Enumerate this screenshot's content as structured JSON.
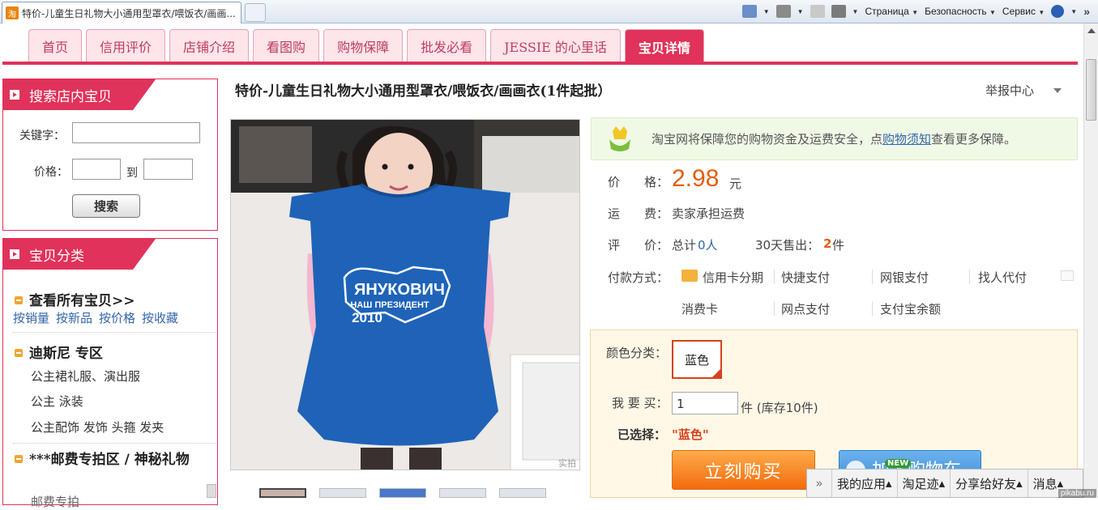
{
  "browser": {
    "tab_title": "特价-儿童生日礼物大小通用型罩衣/喂饭衣/画画...",
    "favicon": "淘",
    "menus": [
      "Страница",
      "Безопасность",
      "Сервис"
    ]
  },
  "nav": {
    "tabs": [
      "首页",
      "信用评价",
      "店铺介绍",
      "看图购",
      "购物保障",
      "批发必看",
      "JESSIE 的心里话",
      "宝贝详情"
    ]
  },
  "search": {
    "heading": "搜索店内宝贝",
    "keyword_label": "关键字：",
    "price_label": "价格：",
    "to_label": "到",
    "button": "搜索"
  },
  "categories": {
    "heading": "宝贝分类",
    "all_items": "查看所有宝贝>>",
    "sorts": [
      "按销量",
      "按新品",
      "按价格",
      "按收藏"
    ],
    "disney": "迪斯尼 专区",
    "disney_items": [
      "公主裙礼服、演出服",
      "公主 泳装",
      "公主配饰 发饰 头箍 发夹"
    ],
    "postage": "***邮费专拍区 / 神秘礼物",
    "postage_sub": "邮费专拍"
  },
  "product": {
    "title": "特价-儿童生日礼物大小通用型罩衣/喂饭衣/画画衣(1件起批）",
    "report": "举报中心",
    "apron_line1": "ЯНУКОВИЧ",
    "apron_line2": "НАШ ПРЕЗИДЕНТ",
    "apron_year": "2010",
    "photo_watermark": "实拍"
  },
  "guarantee": {
    "text_before": "淘宝网将保障您的购物资金及运费安全，点",
    "link": "购物须知",
    "text_after": "查看更多保障。"
  },
  "info": {
    "price_label": "价　　格：",
    "price": "2.98",
    "currency": "元",
    "shipping_label": "运　　费：",
    "shipping": "卖家承担运费",
    "review_label": "评　　价：",
    "review_prefix": "总计",
    "review_count": "0人",
    "sold_label": "30天售出：",
    "sold_count": "2",
    "sold_unit": "件",
    "pay_label": "付款方式：",
    "pay_methods": [
      "信用卡分期",
      "快捷支付",
      "网银支付",
      "找人代付",
      "消费卡",
      "网点支付",
      "支付宝余额"
    ]
  },
  "options": {
    "color_label": "颜色分类：",
    "color_value": "蓝色",
    "qty_label": "我 要 买：",
    "qty_value": "1",
    "stock": "件 (库存10件)",
    "selected_label": "已选择：",
    "selected_value": "\"蓝色\"",
    "buy_button": "立刻购买",
    "cart_button": "加入购物车",
    "cart_badge": "NEW"
  },
  "dock": {
    "items": [
      "我的应用",
      "淘足迹",
      "分享给好友",
      "消息"
    ]
  },
  "watermark": "pikabu.ru",
  "colors": {
    "accent": "#e0325a",
    "price": "#e55c0c",
    "link": "#3366aa"
  }
}
